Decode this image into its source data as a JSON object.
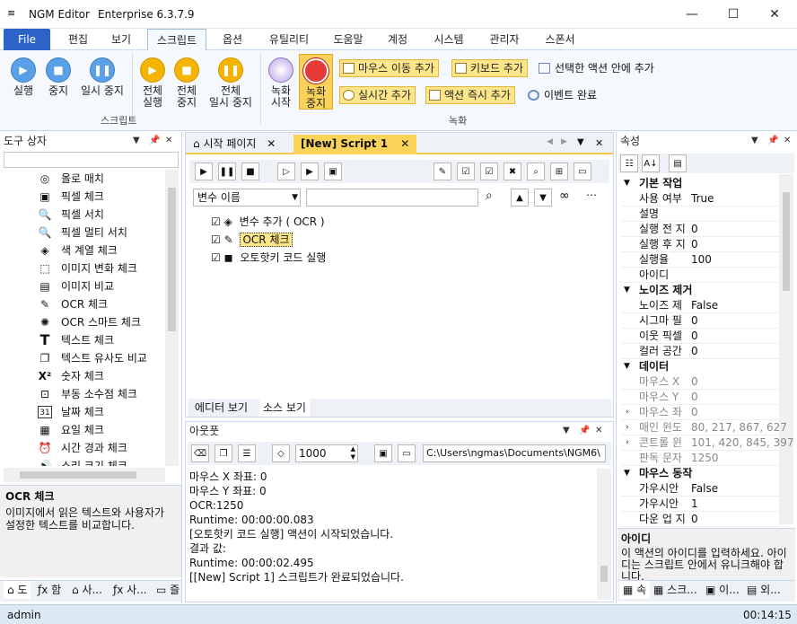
{
  "window": {
    "menu_glyph": "≡",
    "app_name": "NGM Editor",
    "edition": "Enterprise 6.3.7.9",
    "min": "—",
    "max": "☐",
    "close": "✕"
  },
  "ribbon_tabs": [
    "File",
    "편집",
    "보기",
    "스크립트",
    "옵션",
    "유틸리티",
    "도움말",
    "계정",
    "시스템",
    "관리자",
    "스폰서"
  ],
  "ribbon": {
    "script_group": "스크립트",
    "record_group": "녹화",
    "run": "실행",
    "stop": "중지",
    "pause": "일시 중지",
    "run_all_1": "전체",
    "run_all_2": "실행",
    "stop_all_1": "전체",
    "stop_all_2": "중지",
    "pause_all_1": "전체",
    "pause_all_2": "일시 중지",
    "rec_start_1": "녹화",
    "rec_start_2": "시작",
    "rec_stop_1": "녹화",
    "rec_stop_2": "중지",
    "add_mouse": "마우스 이동 추가",
    "add_key": "키보드 추가",
    "in_selected": "선택한 액션 안에 추가",
    "add_realtime": "실시간 추가",
    "add_action_now": "액션 즉시 추가",
    "event_done": "이벤트 완료"
  },
  "toolbox": {
    "title": "도구 상자",
    "items": [
      "올로 매치",
      "픽셀 체크",
      "픽셀 서치",
      "픽셀 멀티 서치",
      "색 계열 체크",
      "이미지 변화 체크",
      "이미지 비교",
      "OCR 체크",
      "OCR 스마트 체크",
      "텍스트 체크",
      "텍스트 유사도 비교",
      "숫자 체크",
      "부동 소수점 체크",
      "날짜 체크",
      "요일 체크",
      "시간 경과 체크",
      "소리 크기 체크"
    ],
    "desc_title": "OCR 체크",
    "desc_text": "이미지에서 읽은 텍스트와 사용자가 설정한 텍스트를 비교합니다.",
    "bottom_tabs": [
      "도",
      "함",
      "사...",
      "사...",
      "즐"
    ]
  },
  "doc_tabs": {
    "start": "시작 페이지",
    "script": "[New] Script 1"
  },
  "editor": {
    "var_select": "변수 이름",
    "actions": [
      "변수 추가 ( OCR )",
      "OCR 체크",
      "오토핫키 코드 실행"
    ],
    "view_tabs": [
      "에디터 보기",
      "소스 보기"
    ]
  },
  "output": {
    "title": "아웃풋",
    "count": "1000",
    "path": "C:\\Users\\ngmas\\Documents\\NGM6\\",
    "lines": [
      "마우스 X 좌표: 0",
      "마우스 Y 좌표: 0",
      "OCR:1250",
      "Runtime: 00:00:00.083",
      "[오토핫키 코드 실행] 액션이 시작되었습니다.",
      "결과 값:",
      "Runtime: 00:00:02.495",
      "[[New] Script 1] 스크립트가 완료되었습니다."
    ]
  },
  "properties": {
    "title": "속성",
    "cat1": "기본 작업",
    "rows1": [
      [
        "사용 여부",
        "True"
      ],
      [
        "설명",
        ""
      ],
      [
        "실행 전 지",
        "0"
      ],
      [
        "실행 후 지",
        "0"
      ],
      [
        "실행율",
        "100"
      ],
      [
        "아이디",
        ""
      ]
    ],
    "cat2": "노이즈 제거",
    "rows2": [
      [
        "노이즈 제",
        "False"
      ],
      [
        "시그마 필",
        "0"
      ],
      [
        "이웃 픽셀",
        "0"
      ],
      [
        "컬러 공간",
        "0"
      ]
    ],
    "cat3": "데이터",
    "rows3": [
      [
        "마우스 X",
        "0"
      ],
      [
        "마우스 Y",
        "0"
      ],
      [
        "마우스 좌",
        "0"
      ],
      [
        "매인 윈도",
        "80, 217, 867, 627"
      ],
      [
        "콘트롤 윈",
        "101, 420, 845, 397"
      ],
      [
        "판독 문자",
        "1250"
      ]
    ],
    "cat4": "마우스 동작",
    "rows4": [
      [
        "가우시안",
        "False"
      ],
      [
        "가우시안",
        "1"
      ],
      [
        "다운 업 지",
        "0"
      ]
    ],
    "desc_title": "아이디",
    "desc_text": "이 액션의 아이디를 입력하세요. 아이디는 스크립트 안에서 유니크해야 합니다.",
    "bottom_tabs": [
      "속",
      "스크...",
      "이...",
      "외..."
    ]
  },
  "status": {
    "user": "admin",
    "time": "00:14:15"
  }
}
